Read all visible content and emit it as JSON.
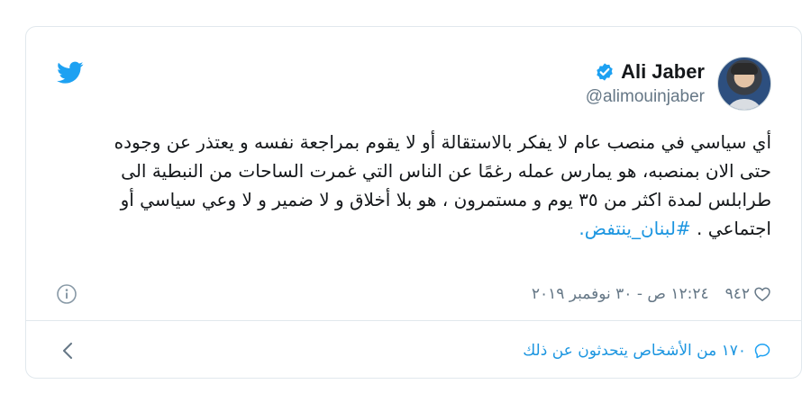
{
  "tweet": {
    "author": {
      "display_name": "Ali Jaber",
      "handle": "@alimouinjaber",
      "verified": true
    },
    "text": "أي سياسي في منصب عام لا يفكر بالاستقالة أو لا يقوم بمراجعة نفسه و يعتذر عن وجوده حتى الان بمنصبه، هو يمارس عمله رغمًا عن الناس التي غمرت الساحات من النبطية الى طرابلس لمدة اكثر من ٣٥ يوم و مستمرون ، هو بلا أخلاق و لا ضمير و لا وعي سياسي أو اجتماعي . ",
    "hashtag": "#لبنان_ينتفض.",
    "likes": "٩٤٢",
    "timestamp": "١٢:٢٤ ص - ٣٠ نوفمبر ٢٠١٩",
    "people_talking": "١٧٠ من الأشخاص يتحدثون عن ذلك"
  },
  "icons": {
    "brand": "twitter-bird-icon",
    "verified": "verified-badge-icon",
    "like": "heart-icon",
    "info": "info-icon",
    "reply": "reply-bubble-icon",
    "chevron": "chevron-left-icon"
  },
  "colors": {
    "twitter_blue": "#1da1f2",
    "link_blue": "#1b95e0",
    "secondary_text": "#657786",
    "primary_text": "#14171a",
    "border": "#e1e8ed"
  }
}
